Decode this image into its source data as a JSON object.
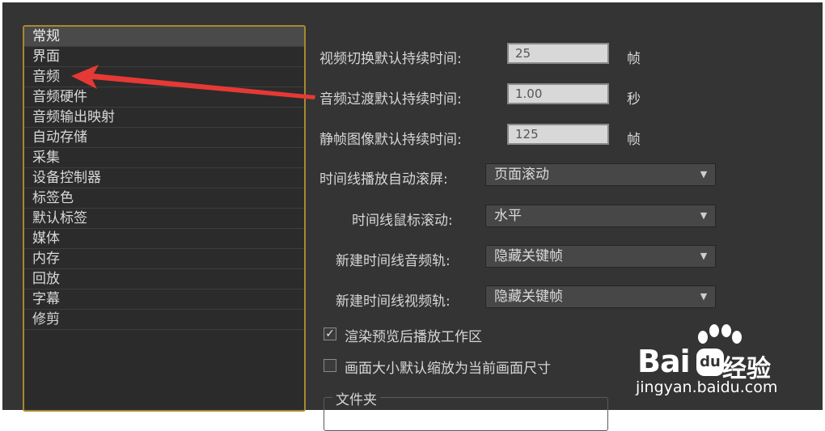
{
  "categories": [
    {
      "label": "常规",
      "selected": true
    },
    {
      "label": "界面",
      "selected": false
    },
    {
      "label": "音频",
      "selected": false
    },
    {
      "label": "音频硬件",
      "selected": false
    },
    {
      "label": "音频输出映射",
      "selected": false
    },
    {
      "label": "自动存储",
      "selected": false
    },
    {
      "label": "采集",
      "selected": false
    },
    {
      "label": "设备控制器",
      "selected": false
    },
    {
      "label": "标签色",
      "selected": false
    },
    {
      "label": "默认标签",
      "selected": false
    },
    {
      "label": "媒体",
      "selected": false
    },
    {
      "label": "内存",
      "selected": false
    },
    {
      "label": "回放",
      "selected": false
    },
    {
      "label": "字幕",
      "selected": false
    },
    {
      "label": "修剪",
      "selected": false
    }
  ],
  "settings": {
    "video_transition": {
      "label": "视频切换默认持续时间:",
      "value": "25",
      "unit": "帧"
    },
    "audio_transition": {
      "label": "音频过渡默认持续时间:",
      "value": "1.00",
      "unit": "秒"
    },
    "still_image": {
      "label": "静帧图像默认持续时间:",
      "value": "125",
      "unit": "帧"
    },
    "autoscroll": {
      "label": "时间线播放自动滚屏:",
      "value": "页面滚动"
    },
    "mouse_scroll": {
      "label": "时间线鼠标滚动:",
      "value": "水平"
    },
    "new_audio_track": {
      "label": "新建时间线音频轨:",
      "value": "隐藏关键帧"
    },
    "new_video_track": {
      "label": "新建时间线视频轨:",
      "value": "隐藏关键帧"
    },
    "render_preview": {
      "label": "渲染预览后播放工作区",
      "checked": true
    },
    "default_scale": {
      "label": "画面大小默认缩放为当前画面尺寸",
      "checked": false
    },
    "folder_group": {
      "label": "文件夹"
    }
  },
  "check_glyph": "✓",
  "dropdown_glyph": "▼",
  "watermark": {
    "logo": "Bai",
    "paw": "du",
    "brand_cn": "经验",
    "url": "jingyan.baidu.com"
  },
  "colors": {
    "panel": "#343434",
    "list_border": "#a8872e",
    "arrow": "#e53935"
  }
}
